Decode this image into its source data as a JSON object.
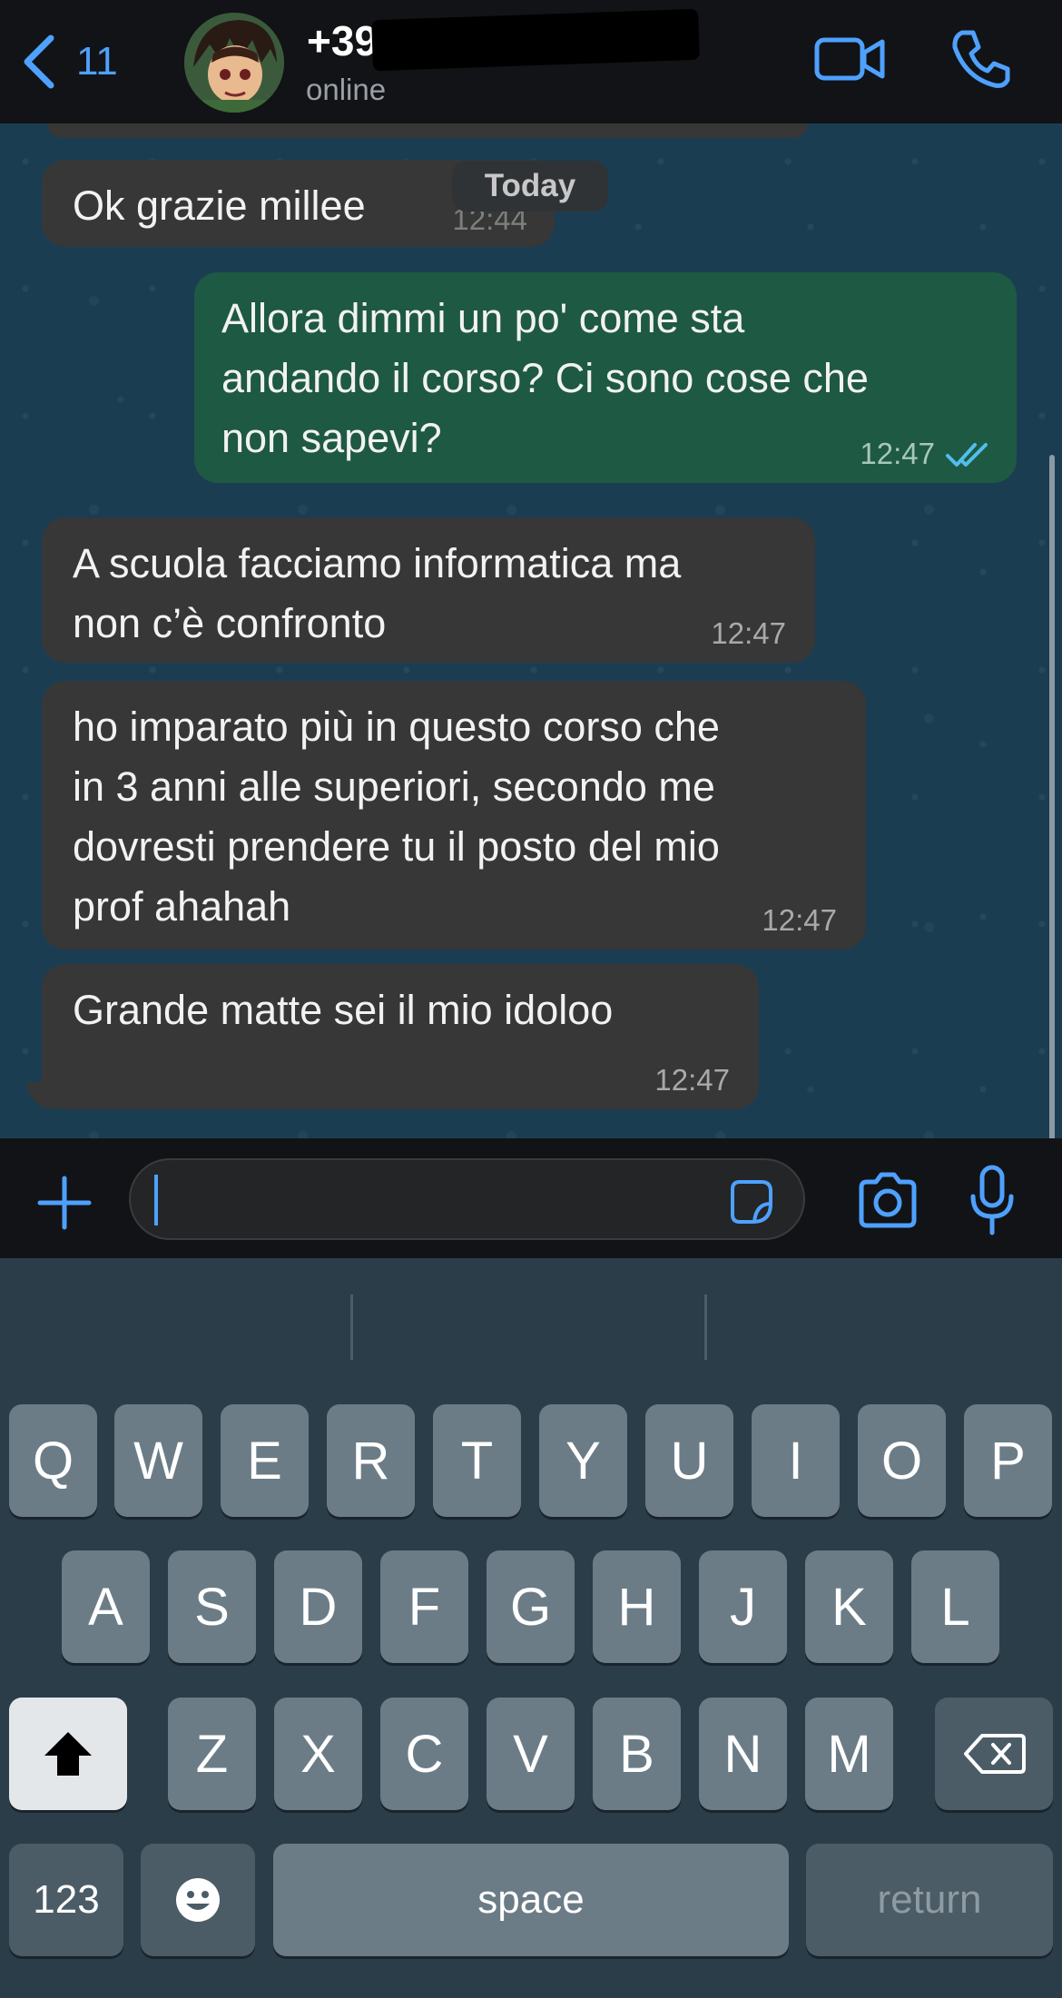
{
  "header": {
    "back_count": "11",
    "contact_name": "+39",
    "status": "online"
  },
  "chat": {
    "date_pill": "Today",
    "messages": [
      {
        "direction": "in",
        "text": "Ok grazie millee",
        "time": "12:44"
      },
      {
        "direction": "out",
        "text": "Allora dimmi un po' come sta\nandando il corso? Ci sono cose che\nnon sapevi?",
        "time": "12:47",
        "status": "read"
      },
      {
        "direction": "in",
        "text": "A scuola facciamo informatica ma\nnon c’è confronto",
        "time": "12:47"
      },
      {
        "direction": "in",
        "text": "ho imparato più in questo corso che\nin 3 anni alle superiori, secondo me\ndovresti prendere tu il posto del mio\nprof ahahah",
        "time": "12:47"
      },
      {
        "direction": "in",
        "text": "Grande matte sei il mio idoloo",
        "time": "12:47"
      }
    ]
  },
  "composer": {
    "input_value": ""
  },
  "keyboard": {
    "row1": [
      "Q",
      "W",
      "E",
      "R",
      "T",
      "Y",
      "U",
      "I",
      "O",
      "P"
    ],
    "row2": [
      "A",
      "S",
      "D",
      "F",
      "G",
      "H",
      "J",
      "K",
      "L"
    ],
    "row3": [
      "Z",
      "X",
      "C",
      "V",
      "B",
      "N",
      "M"
    ],
    "numbers_label": "123",
    "space_label": "space",
    "return_label": "return"
  },
  "colors": {
    "accent": "#4ea1ff",
    "incoming_bubble": "#373737",
    "outgoing_bubble": "#1e5943",
    "chat_wallpaper": "#1b3d52"
  }
}
